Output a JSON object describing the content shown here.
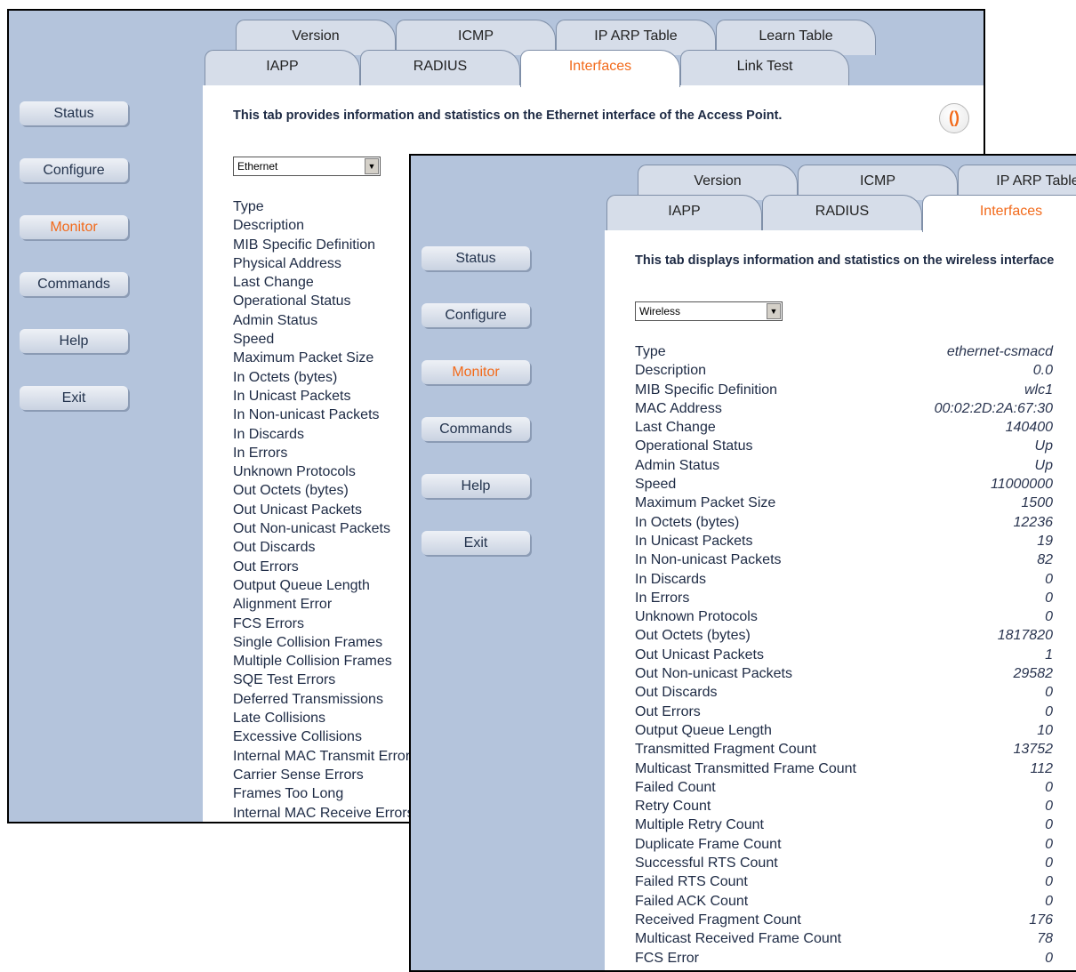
{
  "window1": {
    "tabs_top": [
      "Version",
      "ICMP",
      "IP ARP Table",
      "Learn Table"
    ],
    "tabs_bottom": [
      "IAPP",
      "RADIUS",
      "Interfaces",
      "Link Test"
    ],
    "nav": [
      "Status",
      "Configure",
      "Monitor",
      "Commands",
      "Help",
      "Exit"
    ],
    "description": "This tab provides information and statistics on the Ethernet interface of the Access Point.",
    "help_icon": "help-icon",
    "select_value": "Ethernet",
    "rows": [
      "Type",
      "Description",
      "MIB Specific Definition",
      "Physical Address",
      "Last Change",
      "Operational Status",
      "Admin Status",
      "Speed",
      "Maximum Packet Size",
      "In Octets (bytes)",
      "In Unicast Packets",
      "In Non-unicast Packets",
      "In Discards",
      "In Errors",
      "Unknown Protocols",
      "Out Octets (bytes)",
      "Out Unicast Packets",
      "Out Non-unicast Packets",
      "Out Discards",
      "Out Errors",
      "Output Queue Length",
      "Alignment Error",
      "FCS Errors",
      "Single Collision Frames",
      "Multiple Collision Frames",
      "SQE Test Errors",
      "Deferred Transmissions",
      "Late Collisions",
      "Excessive Collisions",
      "Internal MAC Transmit Errors",
      "Carrier Sense Errors",
      "Frames Too Long",
      "Internal MAC Receive Errors"
    ]
  },
  "window2": {
    "tabs_top": [
      "Version",
      "ICMP",
      "IP ARP Table"
    ],
    "tabs_bottom": [
      "IAPP",
      "RADIUS",
      "Interfaces"
    ],
    "nav": [
      "Status",
      "Configure",
      "Monitor",
      "Commands",
      "Help",
      "Exit"
    ],
    "description": "This tab displays information and statistics on the wireless interface",
    "select_value": "Wireless",
    "rows": [
      {
        "label": "Type",
        "value": "ethernet-csmacd"
      },
      {
        "label": "Description",
        "value": "0.0"
      },
      {
        "label": "MIB Specific Definition",
        "value": "wlc1"
      },
      {
        "label": "MAC Address",
        "value": "00:02:2D:2A:67:30"
      },
      {
        "label": "Last Change",
        "value": "140400"
      },
      {
        "label": "Operational Status",
        "value": "Up"
      },
      {
        "label": "Admin Status",
        "value": "Up"
      },
      {
        "label": "Speed",
        "value": "11000000"
      },
      {
        "label": "Maximum Packet Size",
        "value": "1500"
      },
      {
        "label": "In Octets (bytes)",
        "value": "12236"
      },
      {
        "label": "In Unicast Packets",
        "value": "19"
      },
      {
        "label": "In Non-unicast Packets",
        "value": "82"
      },
      {
        "label": "In Discards",
        "value": "0"
      },
      {
        "label": "In Errors",
        "value": "0"
      },
      {
        "label": "Unknown Protocols",
        "value": "0"
      },
      {
        "label": "Out Octets (bytes)",
        "value": "1817820"
      },
      {
        "label": "Out Unicast Packets",
        "value": "1"
      },
      {
        "label": "Out Non-unicast Packets",
        "value": "29582"
      },
      {
        "label": "Out Discards",
        "value": "0"
      },
      {
        "label": "Out Errors",
        "value": "0"
      },
      {
        "label": "Output Queue Length",
        "value": "10"
      },
      {
        "label": "Transmitted Fragment Count",
        "value": "13752"
      },
      {
        "label": "Multicast Transmitted Frame Count",
        "value": "112"
      },
      {
        "label": "Failed Count",
        "value": "0"
      },
      {
        "label": "Retry Count",
        "value": "0"
      },
      {
        "label": "Multiple Retry Count",
        "value": "0"
      },
      {
        "label": "Duplicate Frame Count",
        "value": "0"
      },
      {
        "label": "Successful RTS Count",
        "value": "0"
      },
      {
        "label": "Failed RTS Count",
        "value": "0"
      },
      {
        "label": "Failed ACK Count",
        "value": "0"
      },
      {
        "label": "Received Fragment Count",
        "value": "176"
      },
      {
        "label": "Multicast Received Frame Count",
        "value": "78"
      },
      {
        "label": "FCS Error",
        "value": "0"
      }
    ]
  },
  "colors": {
    "accent": "#f26a1b",
    "background": "#b4c4dc",
    "text": "#1d2a44"
  }
}
